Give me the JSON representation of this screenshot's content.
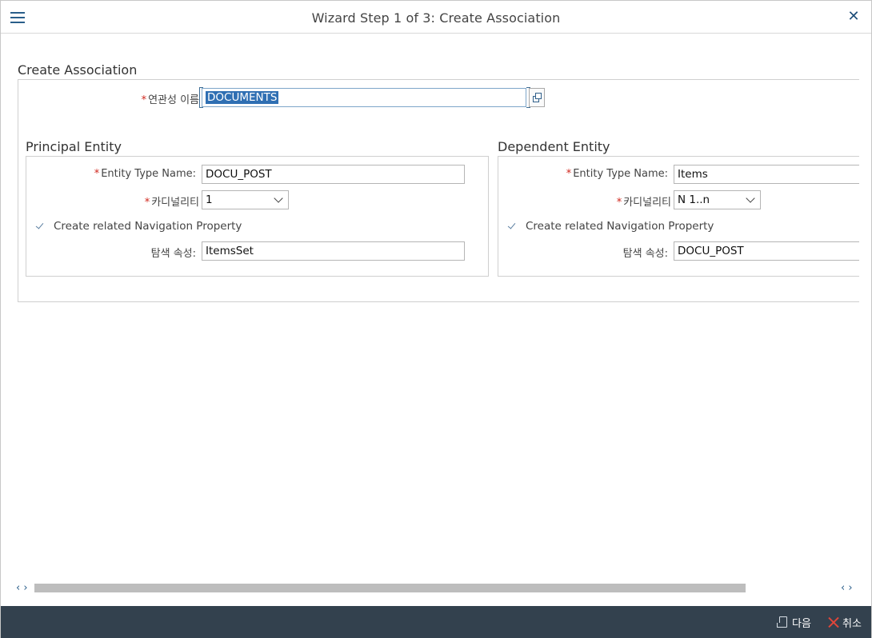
{
  "window": {
    "title": "Wizard Step 1 of 3: Create Association",
    "menu_icon": "hamburger-menu-icon",
    "close_icon": "close-icon"
  },
  "association": {
    "section_title": "Create Association",
    "name_label": "연관성 이름",
    "name_value": "DOCUMENTS",
    "value_help_icon": "value-help-icon"
  },
  "principal": {
    "section_title": "Principal Entity",
    "entity_type_label": "Entity Type Name:",
    "entity_type_value": "DOCU_POST",
    "cardinality_label": "카디널리티",
    "cardinality_value": "1",
    "nav_checkbox_label": "Create related Navigation Property",
    "nav_checked": true,
    "nav_property_label": "탐색 속성:",
    "nav_property_value": "ItemsSet"
  },
  "dependent": {
    "section_title": "Dependent Entity",
    "entity_type_label": "Entity Type Name:",
    "entity_type_value": "Items",
    "cardinality_label": "카디널리티",
    "cardinality_value": "N 1..n",
    "nav_checkbox_label": "Create related Navigation Property",
    "nav_checked": true,
    "nav_property_label": "탐색 속성:",
    "nav_property_value": "DOCU_POST"
  },
  "scrollbar": {
    "left_arrows": "‹ ›",
    "right_arrows": "‹ ›"
  },
  "footer": {
    "next_label": "다음",
    "next_icon": "next-page-icon",
    "cancel_label": "취소",
    "cancel_icon": "cancel-x-icon"
  },
  "colors": {
    "footer_bg": "#33414e",
    "accent": "#2a5e8a",
    "required": "#d0271d",
    "selection": "#2f6fb3"
  }
}
